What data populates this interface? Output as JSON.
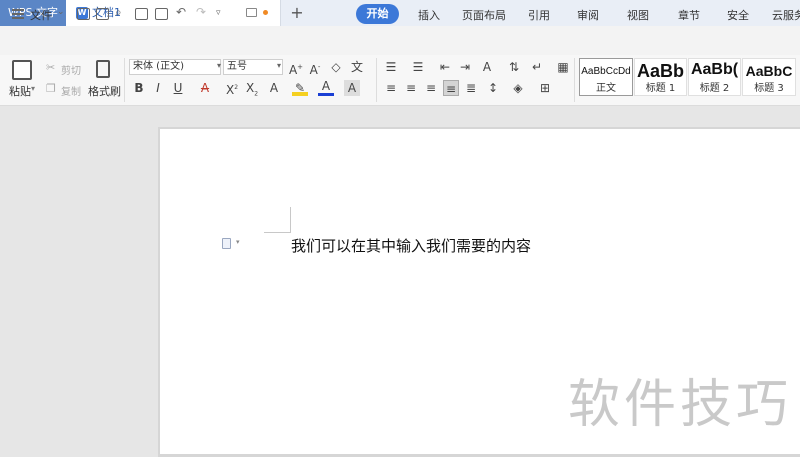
{
  "app": {
    "tab_label": "WPS 文字"
  },
  "document_tab": {
    "title": "文档1",
    "logo": "W"
  },
  "new_tab_label": "+",
  "menu": {
    "file_label": "文件",
    "tabs": [
      "开始",
      "插入",
      "页面布局",
      "引用",
      "审阅",
      "视图",
      "章节",
      "安全",
      "云服务"
    ],
    "active_tab": "开始"
  },
  "ribbon": {
    "clipboard": {
      "paste": "粘贴",
      "cut": "剪切",
      "copy": "复制",
      "format_painter": "格式刷"
    },
    "font": {
      "name": "宋体 (正文)",
      "size": "五号"
    },
    "styles": [
      {
        "preview": "AaBbCcDd",
        "label": "正文"
      },
      {
        "preview": "AaBb",
        "label": "标题 1"
      },
      {
        "preview": "AaBb(",
        "label": "标题 2"
      },
      {
        "preview": "AaBbC",
        "label": "标题 3"
      }
    ]
  },
  "document": {
    "body_text": "我们可以在其中输入我们需要的内容",
    "watermark": "软件技巧"
  },
  "colors": {
    "accent": "#3c78d8",
    "app_tab": "#5b86c6",
    "modified_dot": "#f08a24"
  }
}
